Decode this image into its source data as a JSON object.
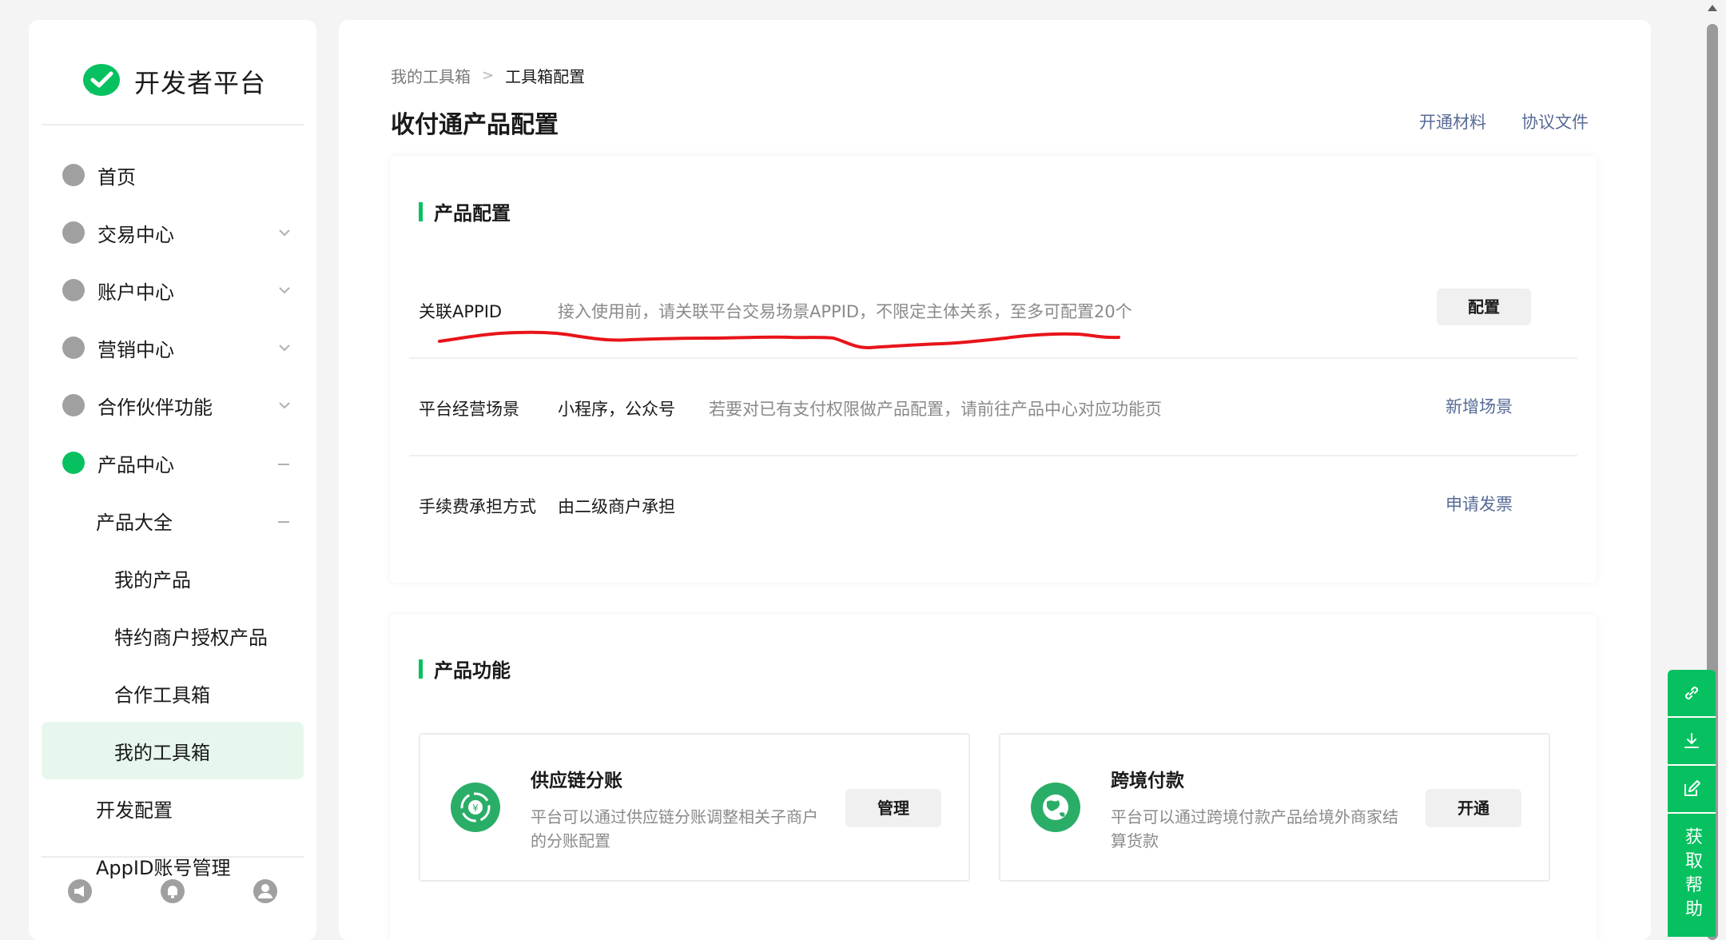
{
  "sidebar": {
    "logo_text": "开发者平台",
    "items": [
      {
        "label": "首页"
      },
      {
        "label": "交易中心"
      },
      {
        "label": "账户中心"
      },
      {
        "label": "营销中心"
      },
      {
        "label": "合作伙伴功能"
      },
      {
        "label": "产品中心"
      },
      {
        "label": "产品大全"
      },
      {
        "label": "我的产品"
      },
      {
        "label": "特约商户授权产品"
      },
      {
        "label": "合作工具箱"
      },
      {
        "label": "我的工具箱"
      },
      {
        "label": "开发配置"
      },
      {
        "label": "AppID账号管理"
      }
    ],
    "footer_icons": [
      "megaphone-icon",
      "bell-icon",
      "user-icon"
    ]
  },
  "breadcrumb": {
    "parent": "我的工具箱",
    "current": "工具箱配置"
  },
  "page": {
    "title": "收付通产品配置",
    "link_materials": "开通材料",
    "link_agreement": "协议文件"
  },
  "product_config": {
    "section_title": "产品配置",
    "rows": [
      {
        "key": "关联APPID",
        "hint": "接入使用前，请关联平台交易场景APPID，不限定主体关系，至多可配置20个",
        "action": "配置"
      },
      {
        "key": "平台经营场景",
        "value": "小程序，公众号",
        "hint": "若要对已有支付权限做产品配置，请前往产品中心对应功能页",
        "action": "新增场景"
      },
      {
        "key": "手续费承担方式",
        "value": "由二级商户承担",
        "action": "申请发票"
      }
    ]
  },
  "product_functions": {
    "section_title": "产品功能",
    "items": [
      {
        "name": "供应链分账",
        "desc": "平台可以通过供应链分账调整相关子商户的分账配置",
        "action": "管理",
        "icon": "yuan-share-icon"
      },
      {
        "name": "跨境付款",
        "desc": "平台可以通过跨境付款产品给境外商家结算货款",
        "action": "开通",
        "icon": "globe-icon"
      }
    ]
  },
  "float_bar": {
    "help_label": "获取帮助",
    "icons": [
      "link-icon",
      "download-icon",
      "edit-icon"
    ]
  },
  "colors": {
    "brand_green": "#07c160",
    "link_blue": "#576b95",
    "annotation_red": "#e8141a"
  }
}
